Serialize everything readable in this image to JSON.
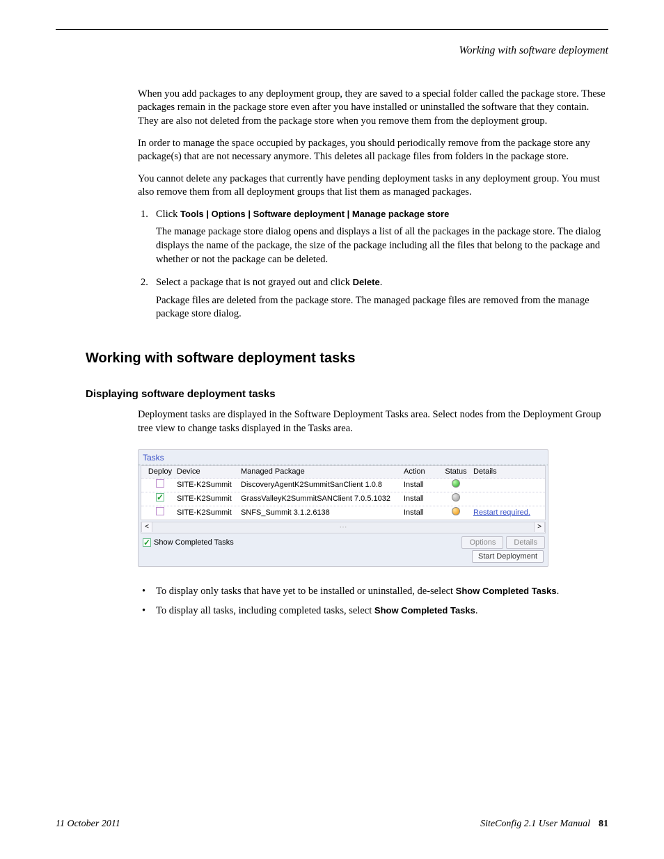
{
  "header": {
    "section_title": "Working with software deployment"
  },
  "paragraphs": {
    "p1": "When you add packages to any deployment group, they are saved to a special folder called the package store. These packages remain in the package store even after you have installed or uninstalled the software that they contain. They are also not deleted from the package store when you remove them from the deployment group.",
    "p2": "In order to manage the space occupied by packages, you should periodically remove from the package store any package(s) that are not necessary anymore. This deletes all package files from folders in the package store.",
    "p3": "You cannot delete any packages that currently have pending deployment tasks in any deployment group. You must also remove them from all deployment groups that list them as managed packages."
  },
  "steps": {
    "s1_click": "Click ",
    "s1_menu": "Tools | Options | Software deployment | Manage package store",
    "s1_body": "The manage package store dialog opens and displays a list of all the packages in the package store. The dialog displays the name of the package, the size of the package including all the files that belong to the package and whether or not the package can be deleted.",
    "s2_lead": "Select a package that is not grayed out and click ",
    "s2_bold": "Delete",
    "s2_tail": ".",
    "s2_body": "Package files are deleted from the package store. The managed package files are removed from the manage package store dialog."
  },
  "headings": {
    "h2": "Working with software deployment tasks",
    "h3": "Displaying software deployment tasks"
  },
  "desc": "Deployment tasks are displayed in the Software Deployment Tasks area. Select nodes from the Deployment Group tree view to change tasks displayed in the Tasks area.",
  "tasks_panel": {
    "title": "Tasks",
    "columns": {
      "deploy": "Deploy",
      "device": "Device",
      "pkg": "Managed Package",
      "action": "Action",
      "status": "Status",
      "details": "Details"
    },
    "rows": [
      {
        "checked": false,
        "device": "SITE-K2Summit",
        "pkg": "DiscoveryAgentK2SummitSanClient 1.0.8",
        "action": "Install",
        "status": "green",
        "details": ""
      },
      {
        "checked": true,
        "device": "SITE-K2Summit",
        "pkg": "GrassValleyK2SummitSANClient 7.0.5.1032",
        "action": "Install",
        "status": "gray",
        "details": ""
      },
      {
        "checked": false,
        "device": "SITE-K2Summit",
        "pkg": "SNFS_Summit 3.1.2.6138",
        "action": "Install",
        "status": "orange",
        "details": "Restart required."
      }
    ],
    "show_completed": "Show Completed Tasks",
    "options_btn": "Options",
    "details_btn": "Details",
    "start_btn": "Start Deployment"
  },
  "post_bullets": {
    "b1_lead": "To display only tasks that have yet to be installed or uninstalled, de-select ",
    "b1_bold": "Show Completed Tasks",
    "b1_tail": ".",
    "b2_lead": "To display all tasks, including completed tasks, select ",
    "b2_bold": "Show Completed Tasks",
    "b2_tail": "."
  },
  "footer": {
    "date": "11 October 2011",
    "manual_italic": "SiteConfig ",
    "manual_rest": "2.1 User Manual",
    "page_num": "81"
  }
}
